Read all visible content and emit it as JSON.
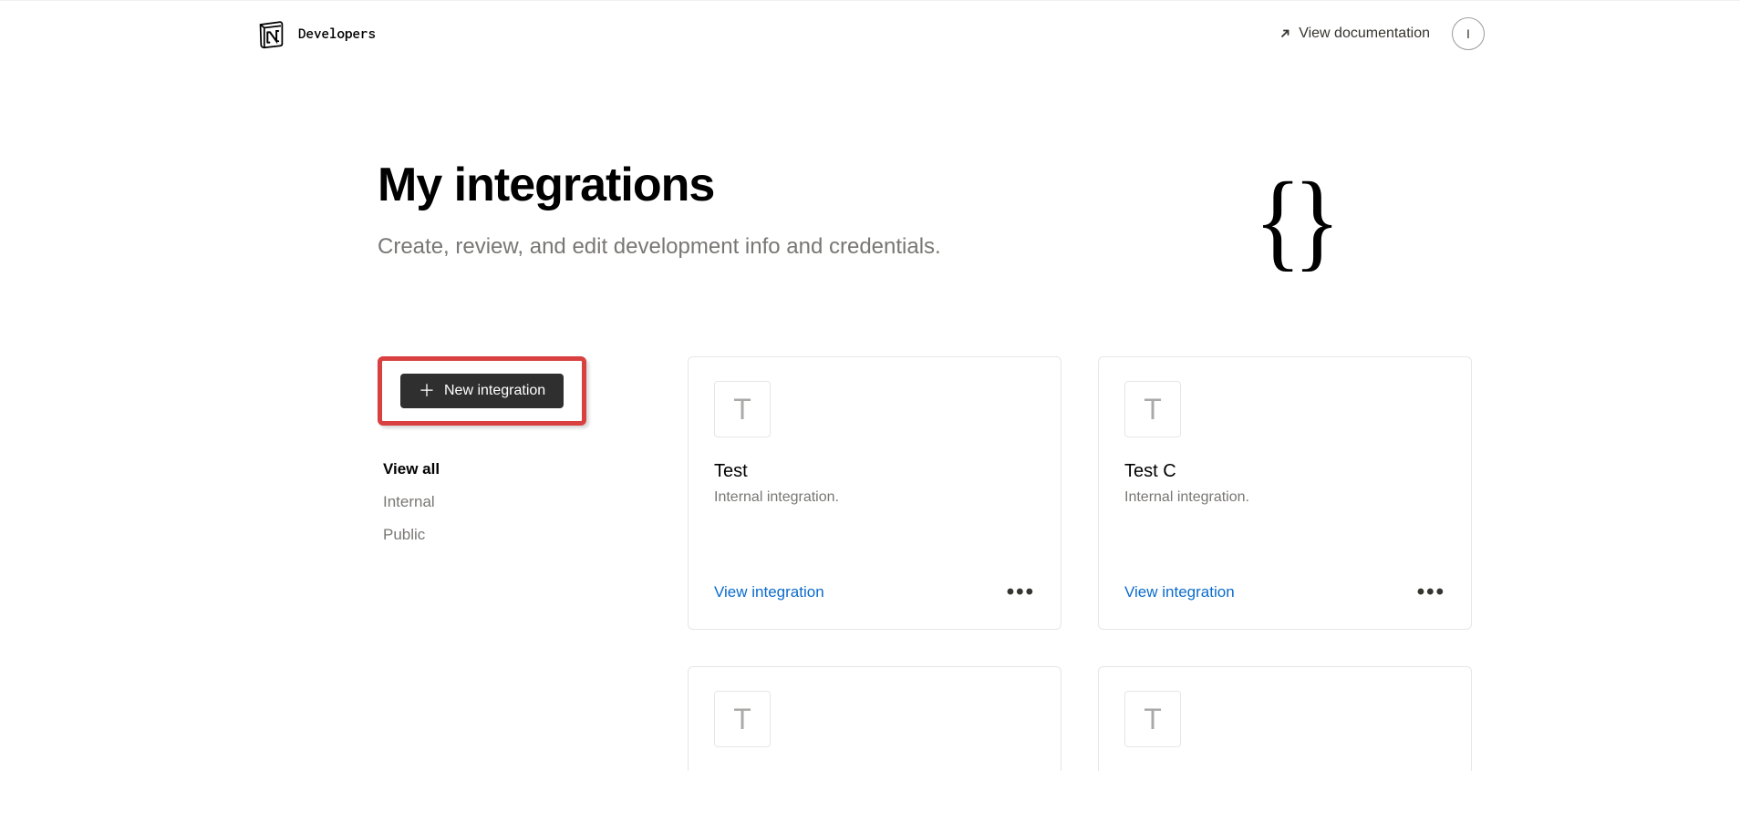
{
  "header": {
    "brand": "Developers",
    "doc_link_label": "View documentation",
    "avatar_initial": "I"
  },
  "hero": {
    "title": "My integrations",
    "subtitle": "Create, review, and edit development info and credentials.",
    "graphic": "{  }"
  },
  "sidebar": {
    "new_integration_label": "New integration",
    "filters": [
      {
        "label": "View all",
        "active": true
      },
      {
        "label": "Internal",
        "active": false
      },
      {
        "label": "Public",
        "active": false
      }
    ]
  },
  "cards": [
    {
      "initial": "T",
      "title": "Test",
      "subtitle": "Internal integration.",
      "action_label": "View integration"
    },
    {
      "initial": "T",
      "title": "Test C",
      "subtitle": "Internal integration.",
      "action_label": "View integration"
    }
  ],
  "partial_cards": [
    {
      "initial": "T"
    },
    {
      "initial": "T"
    }
  ]
}
